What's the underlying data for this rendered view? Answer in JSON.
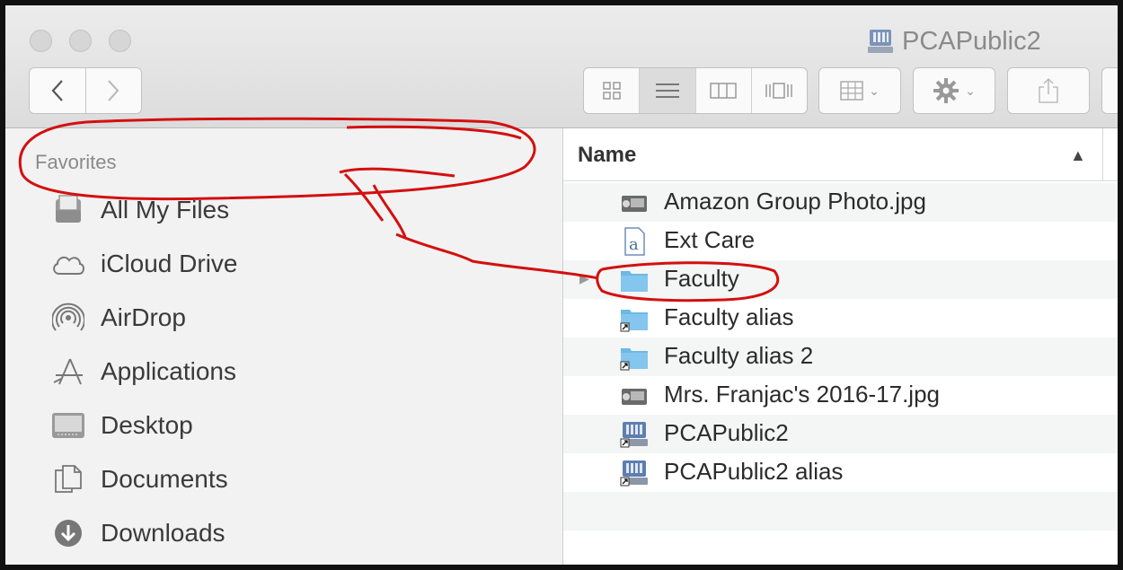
{
  "window": {
    "title": "PCAPublic2"
  },
  "colors": {
    "annotation": "#d40f0f",
    "folder": "#6cb8e6",
    "sidebar_bg": "#f2f2f2"
  },
  "sidebar": {
    "header": "Favorites",
    "items": [
      {
        "label": "All My Files",
        "icon": "all-files-icon"
      },
      {
        "label": "iCloud Drive",
        "icon": "cloud-icon"
      },
      {
        "label": "AirDrop",
        "icon": "airdrop-icon"
      },
      {
        "label": "Applications",
        "icon": "applications-icon"
      },
      {
        "label": "Desktop",
        "icon": "desktop-icon"
      },
      {
        "label": "Documents",
        "icon": "documents-icon"
      },
      {
        "label": "Downloads",
        "icon": "downloads-icon"
      }
    ]
  },
  "list": {
    "column_header": "Name",
    "files": [
      {
        "name": "Amazon Group Photo.jpg",
        "icon": "image-file-icon"
      },
      {
        "name": "Ext Care",
        "icon": "text-file-icon"
      },
      {
        "name": "Faculty",
        "icon": "folder-icon"
      },
      {
        "name": "Faculty alias",
        "icon": "folder-alias-icon"
      },
      {
        "name": "Faculty alias 2",
        "icon": "folder-alias-icon"
      },
      {
        "name": "Mrs. Franjac's 2016-17.jpg",
        "icon": "image-file-icon"
      },
      {
        "name": "PCAPublic2",
        "icon": "server-alias-icon"
      },
      {
        "name": "PCAPublic2 alias",
        "icon": "server-alias-icon"
      }
    ]
  }
}
